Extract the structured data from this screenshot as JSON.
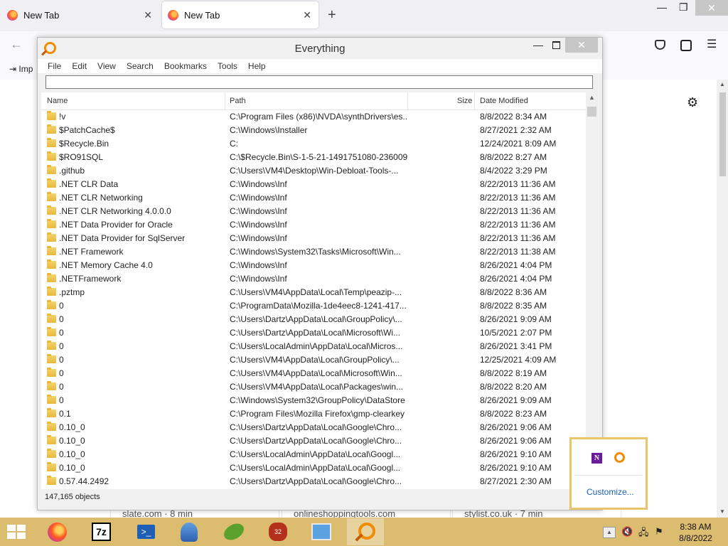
{
  "browser": {
    "tabs": [
      {
        "title": "New Tab",
        "active": false
      },
      {
        "title": "New Tab",
        "active": true
      }
    ],
    "new_tab_symbol": "+",
    "bookmarks": {
      "import_label": "Imp"
    },
    "content_cards": [
      "slate.com · 8 min",
      "onlineshoppingtools.com",
      "stylist.co.uk · 7 min"
    ],
    "icons": [
      "firefox-icon",
      "back-arrow-icon",
      "pocket-icon",
      "account-icon",
      "hamburger-menu-icon",
      "gear-icon"
    ]
  },
  "everything": {
    "title": "Everything",
    "menu": [
      "File",
      "Edit",
      "View",
      "Search",
      "Bookmarks",
      "Tools",
      "Help"
    ],
    "search_value": "",
    "columns": {
      "name": "Name",
      "path": "Path",
      "size": "Size",
      "date": "Date Modified"
    },
    "rows": [
      {
        "name": "!v",
        "path": "C:\\Program Files (x86)\\NVDA\\synthDrivers\\es...",
        "date": "8/8/2022 8:34 AM"
      },
      {
        "name": "$PatchCache$",
        "path": "C:\\Windows\\Installer",
        "date": "8/27/2021 2:32 AM"
      },
      {
        "name": "$Recycle.Bin",
        "path": "C:",
        "date": "12/24/2021 8:09 AM"
      },
      {
        "name": "$RO91SQL",
        "path": "C:\\$Recycle.Bin\\S-1-5-21-1491751080-236009...",
        "date": "8/8/2022 8:27 AM"
      },
      {
        "name": ".github",
        "path": "C:\\Users\\VM4\\Desktop\\Win-Debloat-Tools-...",
        "date": "8/4/2022 3:29 PM"
      },
      {
        "name": ".NET CLR Data",
        "path": "C:\\Windows\\Inf",
        "date": "8/22/2013 11:36 AM"
      },
      {
        "name": ".NET CLR Networking",
        "path": "C:\\Windows\\Inf",
        "date": "8/22/2013 11:36 AM"
      },
      {
        "name": ".NET CLR Networking 4.0.0.0",
        "path": "C:\\Windows\\Inf",
        "date": "8/22/2013 11:36 AM"
      },
      {
        "name": ".NET Data Provider for Oracle",
        "path": "C:\\Windows\\Inf",
        "date": "8/22/2013 11:36 AM"
      },
      {
        "name": ".NET Data Provider for SqlServer",
        "path": "C:\\Windows\\Inf",
        "date": "8/22/2013 11:36 AM"
      },
      {
        "name": ".NET Framework",
        "path": "C:\\Windows\\System32\\Tasks\\Microsoft\\Win...",
        "date": "8/22/2013 11:38 AM"
      },
      {
        "name": ".NET Memory Cache 4.0",
        "path": "C:\\Windows\\Inf",
        "date": "8/26/2021 4:04 PM"
      },
      {
        "name": ".NETFramework",
        "path": "C:\\Windows\\Inf",
        "date": "8/26/2021 4:04 PM"
      },
      {
        "name": ".pztmp",
        "path": "C:\\Users\\VM4\\AppData\\Local\\Temp\\peazip-...",
        "date": "8/8/2022 8:36 AM"
      },
      {
        "name": "0",
        "path": "C:\\ProgramData\\Mozilla-1de4eec8-1241-417...",
        "date": "8/8/2022 8:35 AM"
      },
      {
        "name": "0",
        "path": "C:\\Users\\Dartz\\AppData\\Local\\GroupPolicy\\...",
        "date": "8/26/2021 9:09 AM"
      },
      {
        "name": "0",
        "path": "C:\\Users\\Dartz\\AppData\\Local\\Microsoft\\Wi...",
        "date": "10/5/2021 2:07 PM"
      },
      {
        "name": "0",
        "path": "C:\\Users\\LocalAdmin\\AppData\\Local\\Micros...",
        "date": "8/26/2021 3:41 PM"
      },
      {
        "name": "0",
        "path": "C:\\Users\\VM4\\AppData\\Local\\GroupPolicy\\...",
        "date": "12/25/2021 4:09 AM"
      },
      {
        "name": "0",
        "path": "C:\\Users\\VM4\\AppData\\Local\\Microsoft\\Win...",
        "date": "8/8/2022 8:19 AM"
      },
      {
        "name": "0",
        "path": "C:\\Users\\VM4\\AppData\\Local\\Packages\\win...",
        "date": "8/8/2022 8:20 AM"
      },
      {
        "name": "0",
        "path": "C:\\Windows\\System32\\GroupPolicy\\DataStore",
        "date": "8/26/2021 9:09 AM"
      },
      {
        "name": "0.1",
        "path": "C:\\Program Files\\Mozilla Firefox\\gmp-clearkey",
        "date": "8/8/2022 8:23 AM"
      },
      {
        "name": "0.10_0",
        "path": "C:\\Users\\Dartz\\AppData\\Local\\Google\\Chro...",
        "date": "8/26/2021 9:06 AM"
      },
      {
        "name": "0.10_0",
        "path": "C:\\Users\\Dartz\\AppData\\Local\\Google\\Chro...",
        "date": "8/26/2021 9:06 AM"
      },
      {
        "name": "0.10_0",
        "path": "C:\\Users\\LocalAdmin\\AppData\\Local\\Googl...",
        "date": "8/26/2021 9:10 AM"
      },
      {
        "name": "0.10_0",
        "path": "C:\\Users\\LocalAdmin\\AppData\\Local\\Googl...",
        "date": "8/26/2021 9:10 AM"
      },
      {
        "name": "0.57.44.2492",
        "path": "C:\\Users\\Dartz\\AppData\\Local\\Google\\Chro...",
        "date": "8/27/2021 2:30 AM"
      }
    ],
    "status": "147,165 objects"
  },
  "tray_popup": {
    "nvda_label": "N",
    "customize": "Customize..."
  },
  "taskbar": {
    "apps": [
      "firefox",
      "7-zip",
      "powershell",
      "narrator",
      "peazip",
      "bug-app",
      "control-panel",
      "everything"
    ],
    "sevenzip_label": "7z",
    "bug_label": "32",
    "clock_time": "8:38 AM",
    "clock_date": "8/8/2022"
  }
}
